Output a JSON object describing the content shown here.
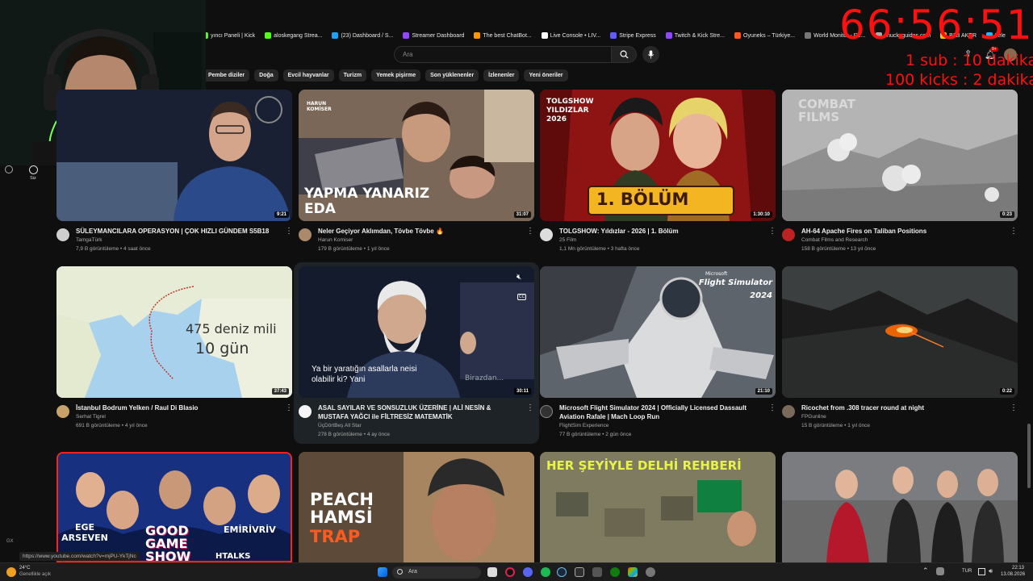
{
  "browser": {
    "bookmarks": [
      {
        "label": "yıncı Paneli | Kick",
        "color": "#53fc18"
      },
      {
        "label": "aloskegang Strea...",
        "color": "#53fc18"
      },
      {
        "label": "(23) Dashboard / S...",
        "color": "#1da1f2"
      },
      {
        "label": "Streamer Dashboard",
        "color": "#9147ff"
      },
      {
        "label": "The best ChatBot...",
        "color": "#ff9800"
      },
      {
        "label": "Live Console • LIV...",
        "color": "#ffffff"
      },
      {
        "label": "Stripe Express",
        "color": "#635bff"
      },
      {
        "label": "Twitch & Kick Stre...",
        "color": "#9147ff"
      },
      {
        "label": "Oyuneks – Türkiye...",
        "color": "#ff5722"
      },
      {
        "label": "World Monitor - Re...",
        "color": "#777777"
      },
      {
        "label": "chucksguides.com",
        "color": "#aaaaaa"
      },
      {
        "label": "B2B AKER",
        "color": "#ffc107"
      },
      {
        "label": "Tele",
        "color": "#29b6f6"
      }
    ]
  },
  "search": {
    "placeholder": "Ara"
  },
  "chips": [
    "Pembe diziler",
    "Doğa",
    "Evcil hayvanlar",
    "Turizm",
    "Yemek pişirme",
    "Son yüklenenler",
    "İzlenenler",
    "Yeni öneriler"
  ],
  "sidebar": {
    "you_label": "Siz",
    "gx_label": "GX"
  },
  "overlay": {
    "timer": "66:56:51",
    "sub_rate": "1 sub : 10 dakika",
    "kick_rate": "100 kicks : 2 dakika"
  },
  "videos": [
    {
      "title": "SÜLEYMANCILARA OPERASYON | ÇOK HIZLI GÜNDEM S5B18",
      "channel": "TamgaTürk",
      "meta": "7,9 B görüntüleme • 4 saat önce",
      "duration": "9:21"
    },
    {
      "title": "Neler Geçiyor Aklımdan, Tövbe Tövbe 🔥",
      "channel": "Harun Komiser",
      "meta": "179 B görüntüleme • 1 yıl önce",
      "duration": "31:07",
      "overlay_small": "HARUN KOMİSER",
      "overlay_big": "YAPMA YANARIZ EDA"
    },
    {
      "title": "TOLGSHOW: Yıldızlar - 2026 | 1. Bölüm",
      "channel": "25 Film",
      "meta": "1,1 Mn görüntüleme • 3 hafta önce",
      "duration": "1:30:10",
      "overlay_small": "TOLGSHOW YILDIZLAR 2026",
      "overlay_big": "1. BÖLÜM"
    },
    {
      "title": "AH-64 Apache Fires on Taliban Positions",
      "channel": "Combat Films and Research",
      "meta": "158 B görüntüleme • 13 yıl önce",
      "duration": "0:23",
      "overlay_big": "COMBAT FILMS"
    },
    {
      "title": "İstanbul Bodrum Yelken / Raul Di Blasio",
      "channel": "Serhat Tigrel",
      "meta": "691 B görüntüleme • 4 yıl önce",
      "duration": "37:43",
      "overlay_big": "475 deniz mili",
      "overlay_small": "10 gün"
    },
    {
      "title": "ASAL SAYILAR VE SONSUZLUK ÜZERİNE | ALİ NESİN & MUSTAFA YAĞCI ile FİLTRESİZ MATEMATİK",
      "channel": "ÜçDörtBeş All Star",
      "meta": "278 B görüntüleme • 4 ay önce",
      "duration": "30:11",
      "overlay_big": "Ya bir yaratığın asallarla neisi olabilir ki? Yani",
      "overlay_small": "Birazdan..."
    },
    {
      "title": "Microsoft Flight Simulator 2024 | Officially Licensed Dassault Aviation Rafale | Mach Loop Run",
      "channel": "FlightSim Experience",
      "meta": "77 B görüntüleme • 2 gün önce",
      "duration": "21:10",
      "overlay_small": "Microsoft",
      "overlay_big": "Flight Simulator 2024"
    },
    {
      "title": "Ricochet from .308 tracer round at night",
      "channel": "FPGunline",
      "meta": "15 B görüntüleme • 1 yıl önce",
      "duration": "0:22"
    },
    {
      "overlay_big": "GOOD GAME SHOW",
      "overlay_small": "EGE ARSEVEN",
      "overlay_small2": "EMİRİVRİV",
      "overlay_small3": "HTALKS"
    },
    {
      "overlay_big": "PEACH HAMSİ",
      "overlay_small": "TRAP"
    },
    {
      "overlay_big": "HER ŞEYİYLE DELHİ REHBERİ"
    },
    {}
  ],
  "statusbar": {
    "url": "https://www.youtube.com/watch?v=mjPU-YkTjNc"
  },
  "taskbar": {
    "weather_temp": "24°C",
    "weather_desc": "Genellikle açık",
    "search": "Ara",
    "lang": "TUR",
    "time": "22:13",
    "date": "13.08.2026"
  },
  "colors": {
    "bg": "#0f0f0f",
    "overlay_red": "#ff1010"
  }
}
